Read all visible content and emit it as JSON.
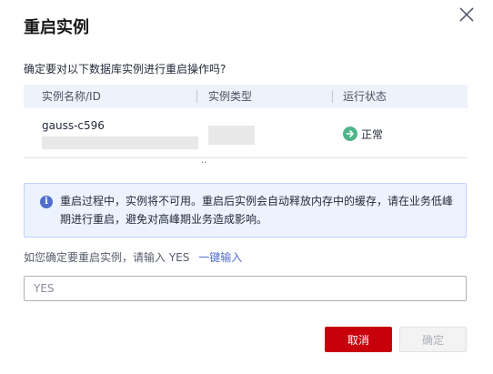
{
  "dialog": {
    "title": "重启实例",
    "question": "确定要对以下数据库实例进行重启操作吗?",
    "close_icon": "close-icon"
  },
  "table": {
    "columns": [
      "实例名称/ID",
      "实例类型",
      "运行状态"
    ],
    "rows": [
      {
        "name": "gauss-c596",
        "id_ellipsis": "..",
        "status": "正常",
        "status_icon": "arrow-right-circle-icon"
      }
    ]
  },
  "info": {
    "icon": "info-icon",
    "text": "重启过程中，实例将不可用。重启后实例会自动释放内存中的缓存，请在业务低峰期进行重启，避免对高峰期业务造成影响。"
  },
  "confirm": {
    "prompt": "如您确定要重启实例，请输入 YES",
    "one_key_label": "一键输入",
    "input_value": "",
    "input_placeholder": "YES"
  },
  "buttons": {
    "cancel_label": "取消",
    "ok_label": "确定"
  },
  "colors": {
    "primary_red": "#c7000b",
    "link_blue": "#526ecc",
    "status_green": "#50b48a",
    "info_bg": "#edf3fe"
  }
}
